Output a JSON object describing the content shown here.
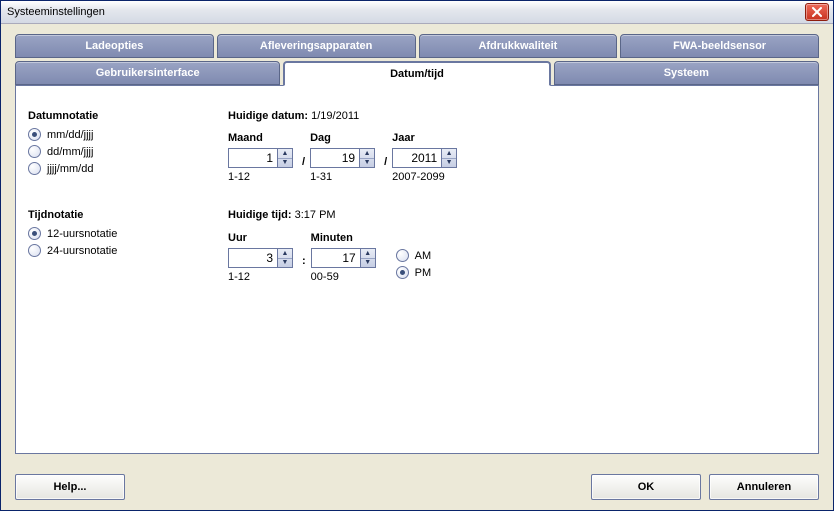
{
  "window_title": "Systeeminstellingen",
  "tabs": {
    "row1": [
      "Ladeopties",
      "Afleveringsapparaten",
      "Afdrukkwaliteit",
      "FWA-beeldsensor"
    ],
    "row2": [
      "Gebruikersinterface",
      "Datum/tijd",
      "Systeem"
    ],
    "active": "Datum/tijd"
  },
  "date_section": {
    "heading": "Datumnotatie",
    "options": [
      "mm/dd/jjjj",
      "dd/mm/jjjj",
      "jjjj/mm/dd"
    ],
    "selected": "mm/dd/jjjj",
    "current_label": "Huidige datum:",
    "current_value": "1/19/2011",
    "fields": {
      "month": {
        "label": "Maand",
        "value": "1",
        "hint": "1-12"
      },
      "day": {
        "label": "Dag",
        "value": "19",
        "hint": "1-31"
      },
      "year": {
        "label": "Jaar",
        "value": "2011",
        "hint": "2007-2099"
      }
    },
    "separator": "/"
  },
  "time_section": {
    "heading": "Tijdnotatie",
    "options": [
      "12-uursnotatie",
      "24-uursnotatie"
    ],
    "selected": "12-uursnotatie",
    "current_label": "Huidige tijd:",
    "current_value": "3:17 PM",
    "fields": {
      "hour": {
        "label": "Uur",
        "value": "3",
        "hint": "1-12"
      },
      "minute": {
        "label": "Minuten",
        "value": "17",
        "hint": "00-59"
      }
    },
    "separator": ":",
    "ampm": {
      "options": [
        "AM",
        "PM"
      ],
      "selected": "PM"
    }
  },
  "buttons": {
    "help": "Help...",
    "ok": "OK",
    "cancel": "Annuleren"
  }
}
